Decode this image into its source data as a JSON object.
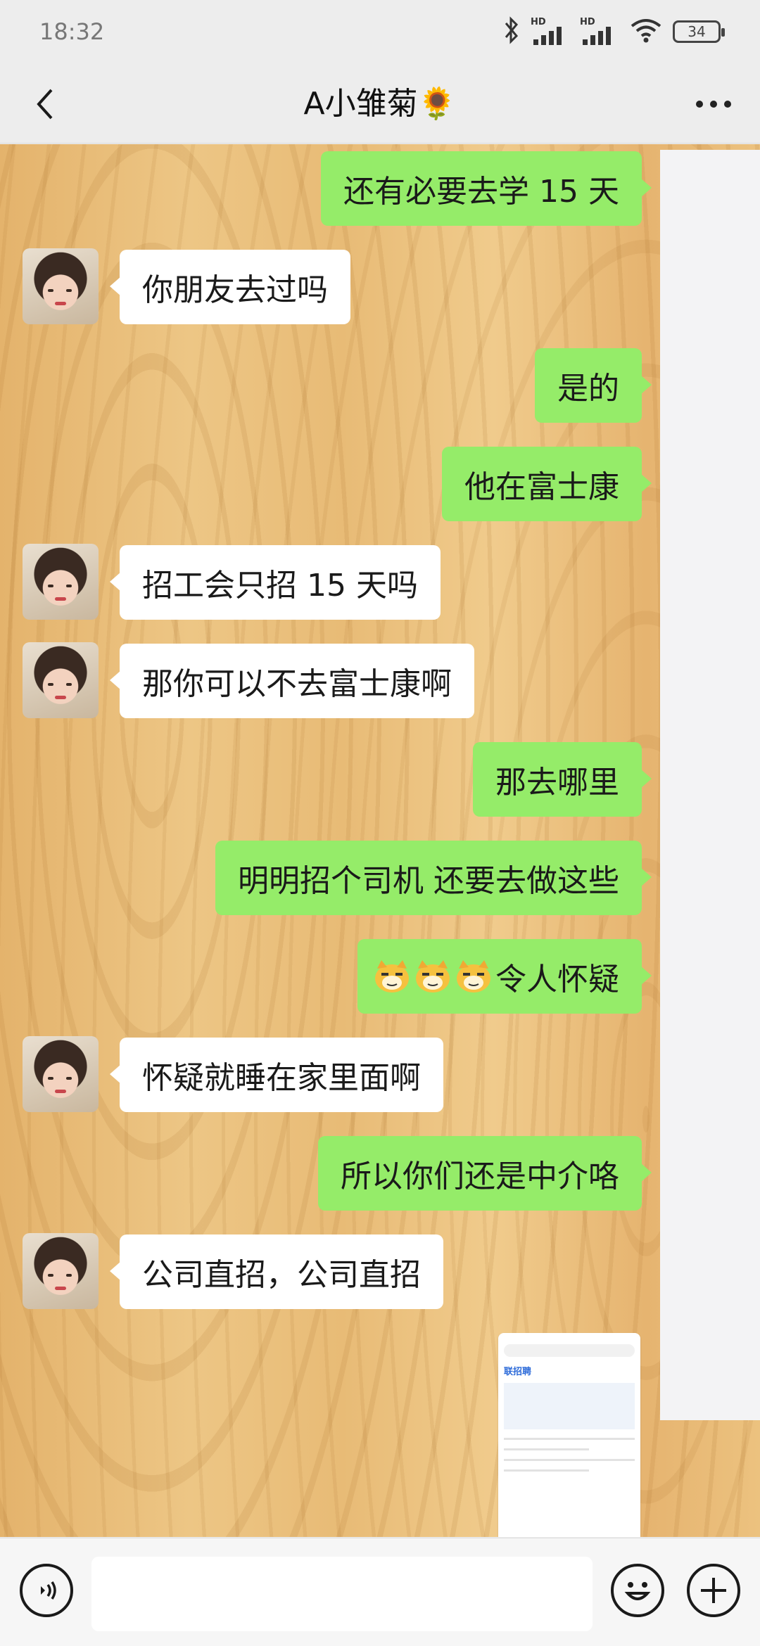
{
  "status_bar": {
    "time": "18:32",
    "signal_label_1": "HD",
    "signal_label_2": "HD",
    "battery": "34"
  },
  "header": {
    "title": "A小雏菊🌻"
  },
  "messages": [
    {
      "side": "out",
      "text": "还有必要去学 15 天"
    },
    {
      "side": "in",
      "text": "你朋友去过吗"
    },
    {
      "side": "out",
      "text": "是的"
    },
    {
      "side": "out",
      "text": "他在富士康"
    },
    {
      "side": "in",
      "text": "招工会只招 15 天吗"
    },
    {
      "side": "in",
      "text": "那你可以不去富士康啊"
    },
    {
      "side": "out",
      "text": "那去哪里"
    },
    {
      "side": "out",
      "text": "明明招个司机  还要去做这些"
    },
    {
      "side": "out",
      "text": "令人怀疑",
      "emoji": "doge",
      "emoji_count": 3
    },
    {
      "side": "in",
      "text": "怀疑就睡在家里面啊"
    },
    {
      "side": "out",
      "text": "所以你们还是中介咯"
    },
    {
      "side": "in",
      "text": "公司直招，公司直招"
    },
    {
      "side": "out",
      "type": "image",
      "brand": "联招聘"
    }
  ],
  "input": {
    "placeholder": "",
    "value": ""
  }
}
